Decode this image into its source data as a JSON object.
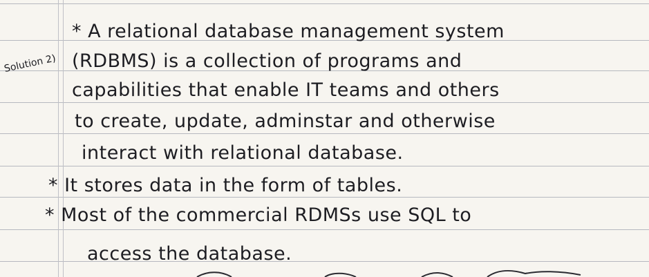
{
  "page": {
    "label": "Solution 2)",
    "lines": [
      "* A relational database management system",
      "(RDBMS) is a collection of programs and",
      "capabilities that enable IT teams and others",
      "to create, update, adminstar and otherwise",
      "interact with relational database.",
      "* It stores data in the form of tables.",
      "* Most of the commercial RDMSs use SQL to",
      "access the database."
    ]
  }
}
